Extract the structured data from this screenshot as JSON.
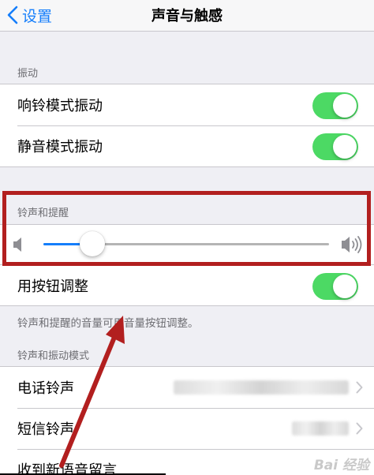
{
  "nav": {
    "back_label": "设置",
    "title": "声音与触感"
  },
  "vibration": {
    "header": "振动",
    "items": [
      {
        "label": "响铃模式振动",
        "on": true
      },
      {
        "label": "静音模式振动",
        "on": true
      }
    ]
  },
  "ringer": {
    "header": "铃声和提醒",
    "volume_fraction": 0.17,
    "button_adjust": {
      "label": "用按钮调整",
      "on": true
    },
    "footer": "铃声和提醒的音量可用音量按钮调整。"
  },
  "patterns": {
    "header": "铃声和振动模式",
    "items": [
      {
        "label": "电话铃声"
      },
      {
        "label": "短信铃声"
      },
      {
        "label": "收到新语音留言"
      }
    ]
  },
  "watermark": "Bai 经验",
  "colors": {
    "accent": "#157efb",
    "toggle_on": "#4cd964",
    "annotation": "#b21f1f",
    "background": "#efeff4"
  }
}
